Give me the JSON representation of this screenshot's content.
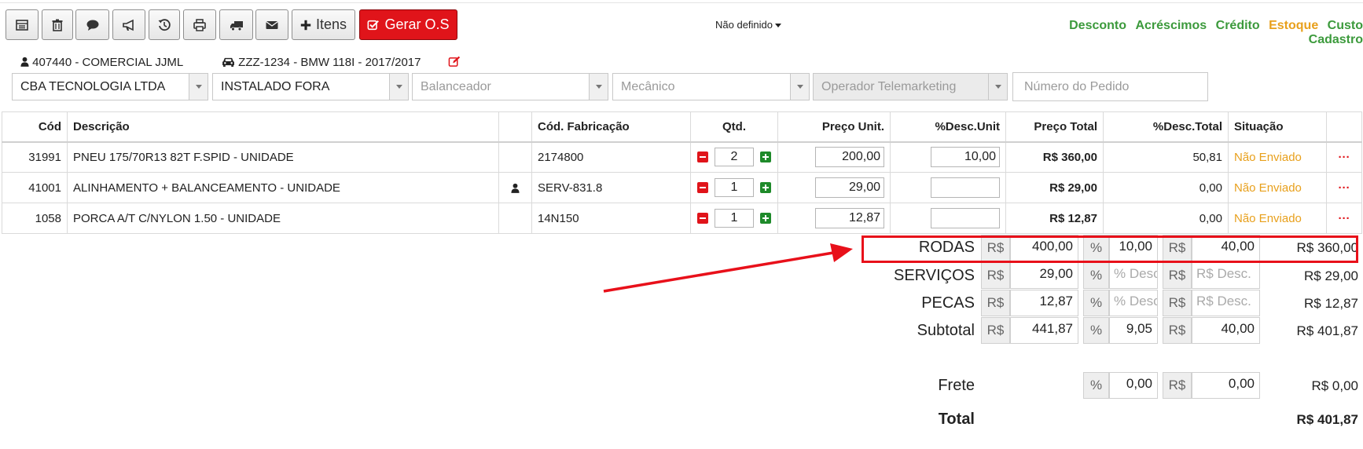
{
  "toolbar": {
    "itens_label": "Itens",
    "gerar_label": "Gerar O.S",
    "status_dropdown": "Não definido"
  },
  "links": {
    "desconto": "Desconto",
    "acrescimos": "Acréscimos",
    "credito": "Crédito",
    "estoque": "Estoque",
    "custo": "Custo",
    "cadastro": "Cadastro"
  },
  "customer": "407440 - COMERCIAL JJML",
  "vehicle": "ZZZ-1234 - BMW 118I - 2017/2017",
  "selects": {
    "empresa": "CBA TECNOLOGIA LTDA",
    "local": "INSTALADO FORA",
    "balanceador": "Balanceador",
    "mecanico": "Mecânico",
    "operador": "Operador Telemarketing",
    "pedido_placeholder": "Número do Pedido"
  },
  "table": {
    "headers": {
      "cod": "Cód",
      "descricao": "Descrição",
      "cod_fab": "Cód. Fabricação",
      "qtd": "Qtd.",
      "preco_unit": "Preço Unit.",
      "desc_unit": "%Desc.Unit",
      "preco_total": "Preço Total",
      "desc_total": "%Desc.Total",
      "situacao": "Situação"
    },
    "rows": [
      {
        "cod": "31991",
        "descricao": "PNEU 175/70R13 82T F.SPID - UNIDADE",
        "cod_fab": "2174800",
        "qtd": "2",
        "preco_unit": "200,00",
        "desc_unit": "10,00",
        "preco_total": "R$ 360,00",
        "desc_total": "50,81",
        "situacao": "Não Enviado",
        "actions": "···"
      },
      {
        "cod": "41001",
        "descricao": "ALINHAMENTO + BALANCEAMENTO - UNIDADE",
        "cod_fab": "SERV-831.8",
        "qtd": "1",
        "preco_unit": "29,00",
        "desc_unit": "",
        "preco_total": "R$ 29,00",
        "desc_total": "0,00",
        "situacao": "Não Enviado",
        "actions": "···"
      },
      {
        "cod": "1058",
        "descricao": "PORCA A/T C/NYLON 1.50 - UNIDADE",
        "cod_fab": "14N150",
        "qtd": "1",
        "preco_unit": "12,87",
        "desc_unit": "",
        "preco_total": "R$ 12,87",
        "desc_total": "0,00",
        "situacao": "Não Enviado",
        "actions": "···"
      }
    ]
  },
  "summary": {
    "currency": "R$",
    "percent": "%",
    "rodas": {
      "label": "RODAS",
      "valor": "400,00",
      "pct": "10,00",
      "desc": "40,00",
      "total": "R$ 360,00"
    },
    "servicos": {
      "label": "SERVIÇOS",
      "valor": "29,00",
      "pct_ph": "% Desc.",
      "desc_ph": "R$ Desc.",
      "total": "R$ 29,00"
    },
    "pecas": {
      "label": "PECAS",
      "valor": "12,87",
      "pct_ph": "% Desc.",
      "desc_ph": "R$ Desc.",
      "total": "R$ 12,87"
    },
    "subtotal": {
      "label": "Subtotal",
      "valor": "441,87",
      "pct": "9,05",
      "desc": "40,00",
      "total": "R$ 401,87"
    },
    "frete": {
      "label": "Frete",
      "pct": "0,00",
      "valor": "0,00",
      "total": "R$ 0,00"
    },
    "total": {
      "label": "Total",
      "valor": "R$ 401,87"
    }
  },
  "colors": {
    "highlight": "#e8101a",
    "link_green": "#3c9a3c",
    "link_orange": "#e8a01c",
    "gerar_red": "#e0141a"
  }
}
